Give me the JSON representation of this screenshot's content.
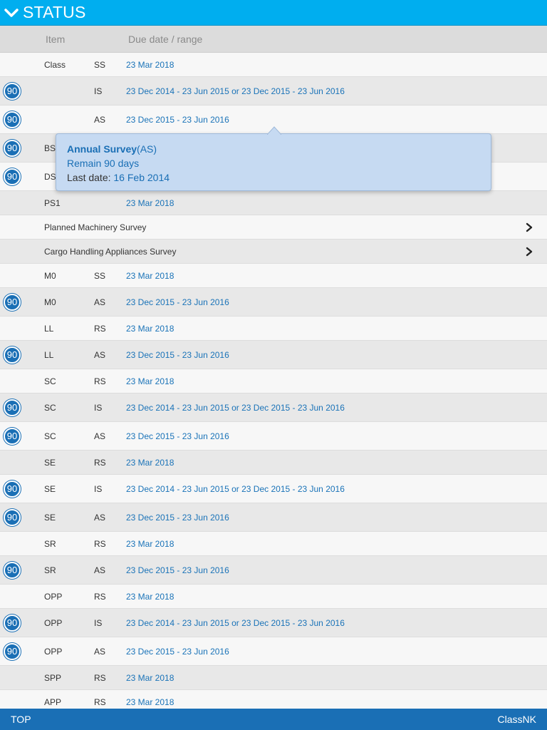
{
  "header": {
    "title": "STATUS"
  },
  "columns": {
    "item": "Item",
    "due": "Due date / range"
  },
  "colors": {
    "accent": "#00aeef",
    "footer": "#1a6fb5",
    "link": "#1a73b8"
  },
  "rows": [
    {
      "type": "survey",
      "item": "Class",
      "code": "SS",
      "due": "23 Mar 2018",
      "badge": ""
    },
    {
      "type": "survey",
      "item": "",
      "code": "IS",
      "due": "23 Dec 2014 - 23 Jun 2015 or 23 Dec 2015 - 23 Jun 2016",
      "badge": "90"
    },
    {
      "type": "survey",
      "item": "",
      "code": "AS",
      "due": "23 Dec 2015 - 23 Jun 2016",
      "badge": "90"
    },
    {
      "type": "survey",
      "item": "BS",
      "code": "",
      "due": "",
      "badge": "90"
    },
    {
      "type": "survey",
      "item": "DS",
      "code": "",
      "due": "",
      "badge": "90"
    },
    {
      "type": "survey",
      "item": "PS1",
      "code": "",
      "due": "23 Mar 2018",
      "badge": ""
    },
    {
      "type": "link",
      "label": "Planned Machinery Survey"
    },
    {
      "type": "link",
      "label": "Cargo Handling Appliances Survey"
    },
    {
      "type": "survey",
      "item": "M0",
      "code": "SS",
      "due": "23 Mar 2018",
      "badge": ""
    },
    {
      "type": "survey",
      "item": "M0",
      "code": "AS",
      "due": "23 Dec 2015 - 23 Jun 2016",
      "badge": "90"
    },
    {
      "type": "survey",
      "item": "LL",
      "code": "RS",
      "due": "23 Mar 2018",
      "badge": ""
    },
    {
      "type": "survey",
      "item": "LL",
      "code": "AS",
      "due": "23 Dec 2015 - 23 Jun 2016",
      "badge": "90"
    },
    {
      "type": "survey",
      "item": "SC",
      "code": "RS",
      "due": "23 Mar 2018",
      "badge": ""
    },
    {
      "type": "survey",
      "item": "SC",
      "code": "IS",
      "due": "23 Dec 2014 - 23 Jun 2015 or 23 Dec 2015 - 23 Jun 2016",
      "badge": "90"
    },
    {
      "type": "survey",
      "item": "SC",
      "code": "AS",
      "due": "23 Dec 2015 - 23 Jun 2016",
      "badge": "90"
    },
    {
      "type": "survey",
      "item": "SE",
      "code": "RS",
      "due": "23 Mar 2018",
      "badge": ""
    },
    {
      "type": "survey",
      "item": "SE",
      "code": "IS",
      "due": "23 Dec 2014 - 23 Jun 2015 or 23 Dec 2015 - 23 Jun 2016",
      "badge": "90"
    },
    {
      "type": "survey",
      "item": "SE",
      "code": "AS",
      "due": "23 Dec 2015 - 23 Jun 2016",
      "badge": "90"
    },
    {
      "type": "survey",
      "item": "SR",
      "code": "RS",
      "due": "23 Mar 2018",
      "badge": ""
    },
    {
      "type": "survey",
      "item": "SR",
      "code": "AS",
      "due": "23 Dec 2015 - 23 Jun 2016",
      "badge": "90"
    },
    {
      "type": "survey",
      "item": "OPP",
      "code": "RS",
      "due": "23 Mar 2018",
      "badge": ""
    },
    {
      "type": "survey",
      "item": "OPP",
      "code": "IS",
      "due": "23 Dec 2014 - 23 Jun 2015 or 23 Dec 2015 - 23 Jun 2016",
      "badge": "90"
    },
    {
      "type": "survey",
      "item": "OPP",
      "code": "AS",
      "due": "23 Dec 2015 - 23 Jun 2016",
      "badge": "90"
    },
    {
      "type": "survey",
      "item": "SPP",
      "code": "RS",
      "due": "23 Mar 2018",
      "badge": ""
    },
    {
      "type": "survey",
      "item": "APP",
      "code": "RS",
      "due": "23 Mar 2018",
      "badge": ""
    }
  ],
  "tooltip": {
    "title": "Annual Survey",
    "code": "(AS)",
    "remain": "Remain 90 days",
    "last_label": "Last date: ",
    "last_value": "16 Feb 2014"
  },
  "footer": {
    "top": "TOP",
    "brand": "ClassNK"
  }
}
